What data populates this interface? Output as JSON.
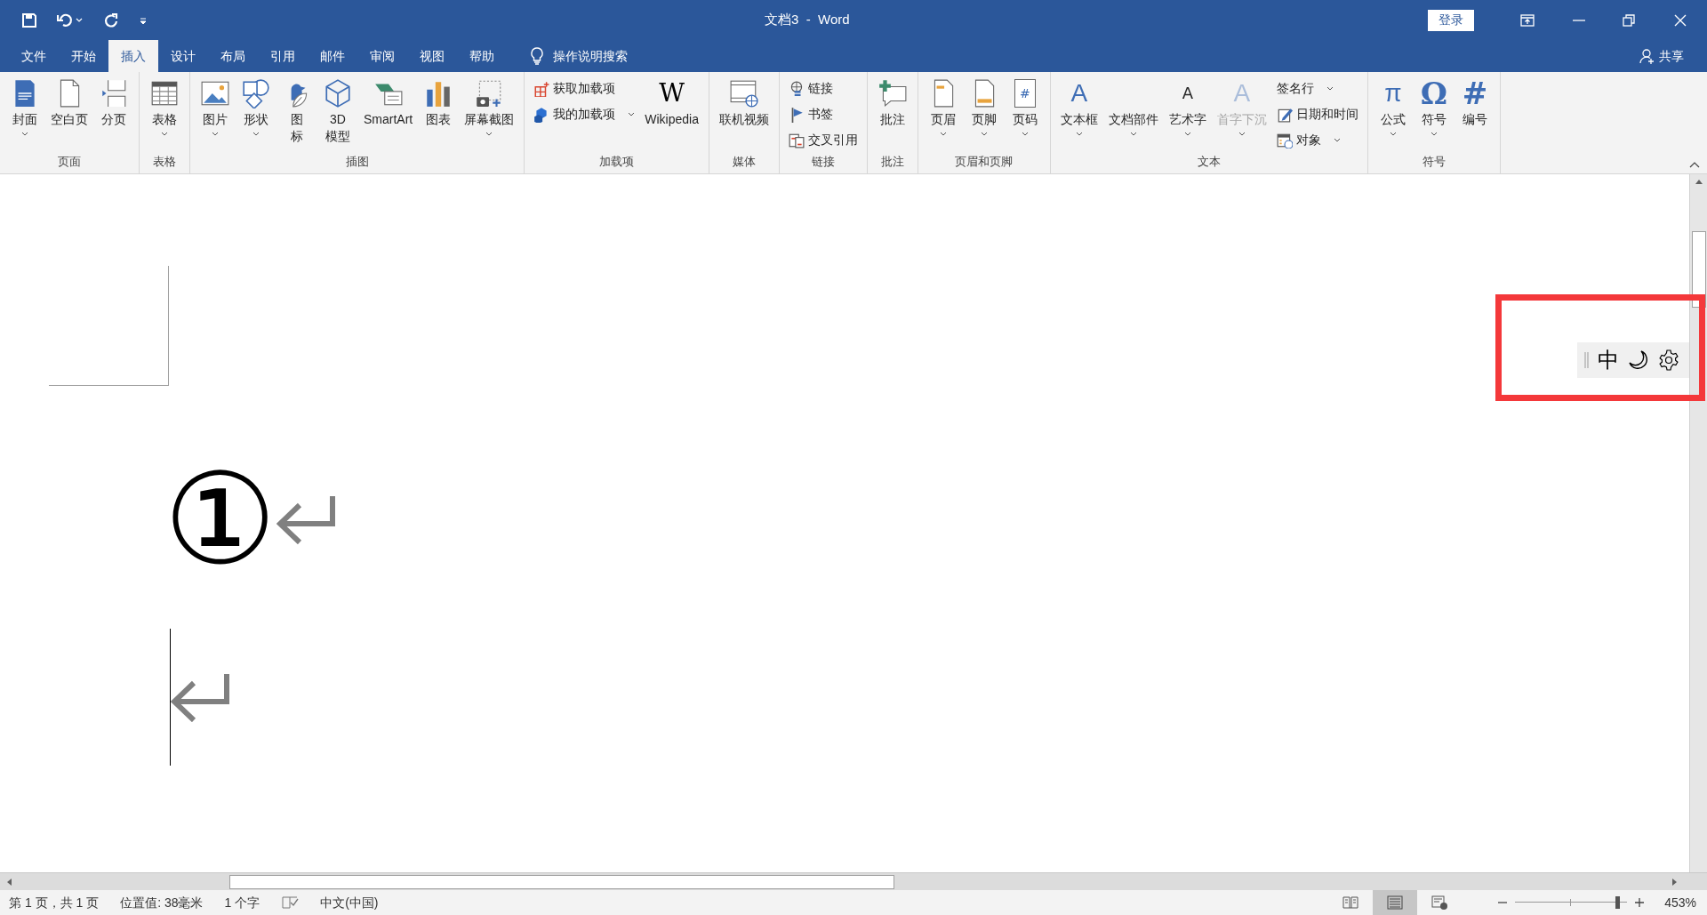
{
  "title_bar": {
    "title": "文档3  -  Word",
    "login_button": "登录"
  },
  "tabs": [
    {
      "label": "文件",
      "selected": false
    },
    {
      "label": "开始",
      "selected": false
    },
    {
      "label": "插入",
      "selected": true
    },
    {
      "label": "设计",
      "selected": false
    },
    {
      "label": "布局",
      "selected": false
    },
    {
      "label": "引用",
      "selected": false
    },
    {
      "label": "邮件",
      "selected": false
    },
    {
      "label": "审阅",
      "selected": false
    },
    {
      "label": "视图",
      "selected": false
    },
    {
      "label": "帮助",
      "selected": false
    }
  ],
  "tell_me": "操作说明搜索",
  "share": "共享",
  "ribbon": [
    {
      "label": "页面",
      "items": [
        {
          "kind": "large",
          "label": "封面",
          "dropdown": true,
          "disabled": false
        },
        {
          "kind": "large",
          "label": "空白页",
          "dropdown": false,
          "disabled": false
        },
        {
          "kind": "large",
          "label": "分页",
          "dropdown": false,
          "disabled": false
        }
      ]
    },
    {
      "label": "表格",
      "items": [
        {
          "kind": "large",
          "label": "表格",
          "dropdown": true,
          "disabled": false
        }
      ]
    },
    {
      "label": "插图",
      "items": [
        {
          "kind": "large",
          "label": "图片",
          "dropdown": true,
          "disabled": false
        },
        {
          "kind": "large",
          "label": "形状",
          "dropdown": true,
          "disabled": false
        },
        {
          "kind": "large",
          "label": "图标",
          "dropdown": false,
          "disabled": false
        },
        {
          "kind": "large",
          "label": "3D模型",
          "dropdown": false,
          "disabled": false
        },
        {
          "kind": "large",
          "label": "SmartArt",
          "dropdown": false,
          "disabled": false
        },
        {
          "kind": "large",
          "label": "图表",
          "dropdown": false,
          "disabled": false
        },
        {
          "kind": "large",
          "label": "屏幕截图",
          "dropdown": true,
          "disabled": false
        }
      ]
    },
    {
      "label": "加载项",
      "items": [
        {
          "kind": "small",
          "label": "获取加载项",
          "dropdown": false,
          "disabled": false
        },
        {
          "kind": "small",
          "label": "我的加载项",
          "dropdown": true,
          "disabled": false
        },
        {
          "kind": "large",
          "label": "Wikipedia",
          "glyph": "W",
          "dropdown": false,
          "disabled": false
        }
      ]
    },
    {
      "label": "媒体",
      "items": [
        {
          "kind": "large",
          "label": "联机视频",
          "dropdown": false,
          "disabled": false
        }
      ]
    },
    {
      "label": "链接",
      "items": [
        {
          "kind": "small",
          "label": "链接",
          "dropdown": false,
          "disabled": false
        },
        {
          "kind": "small",
          "label": "书签",
          "dropdown": false,
          "disabled": false
        },
        {
          "kind": "small",
          "label": "交叉引用",
          "dropdown": false,
          "disabled": false
        }
      ]
    },
    {
      "label": "批注",
      "items": [
        {
          "kind": "large",
          "label": "批注",
          "dropdown": false,
          "disabled": false
        }
      ]
    },
    {
      "label": "页眉和页脚",
      "items": [
        {
          "kind": "large",
          "label": "页眉",
          "dropdown": true,
          "disabled": false
        },
        {
          "kind": "large",
          "label": "页脚",
          "dropdown": true,
          "disabled": false
        },
        {
          "kind": "large",
          "label": "页码",
          "glyph": "#",
          "dropdown": true,
          "disabled": false
        }
      ]
    },
    {
      "label": "文本",
      "items": [
        {
          "kind": "large",
          "label": "文本框",
          "glyph": "A",
          "dropdown": true,
          "disabled": false
        },
        {
          "kind": "large",
          "label": "文档部件",
          "dropdown": true,
          "disabled": false
        },
        {
          "kind": "large",
          "label": "艺术字",
          "glyph": "A",
          "dropdown": true,
          "disabled": false
        },
        {
          "kind": "large",
          "label": "首字下沉",
          "glyph": "A",
          "dropdown": true,
          "disabled": true
        },
        {
          "kind": "small",
          "label": "签名行",
          "dropdown": true,
          "disabled": false
        },
        {
          "kind": "small",
          "label": "日期和时间",
          "dropdown": false,
          "disabled": false
        },
        {
          "kind": "small",
          "label": "对象",
          "dropdown": true,
          "disabled": false
        }
      ]
    },
    {
      "label": "符号",
      "items": [
        {
          "kind": "large",
          "label": "公式",
          "glyph": "π",
          "dropdown": true,
          "disabled": false
        },
        {
          "kind": "large",
          "label": "符号",
          "glyph": "Ω",
          "dropdown": true,
          "disabled": false
        },
        {
          "kind": "large",
          "label": "编号",
          "glyph": "#",
          "dropdown": false,
          "disabled": false
        }
      ]
    }
  ],
  "document": {
    "paragraphs": [
      {
        "text": "①",
        "cursor": false
      },
      {
        "cursor": true
      }
    ]
  },
  "ime_toolbar": {
    "mode": "中"
  },
  "status_bar": {
    "items": [
      "第 1 页，共 1 页",
      "位置值: 38毫米",
      "1 个字"
    ],
    "language": "中文(中国)",
    "views": [
      {
        "selected": false
      },
      {
        "selected": true
      },
      {
        "selected": false
      }
    ],
    "zoom": {
      "level": 0.93,
      "reading": "453%"
    }
  }
}
